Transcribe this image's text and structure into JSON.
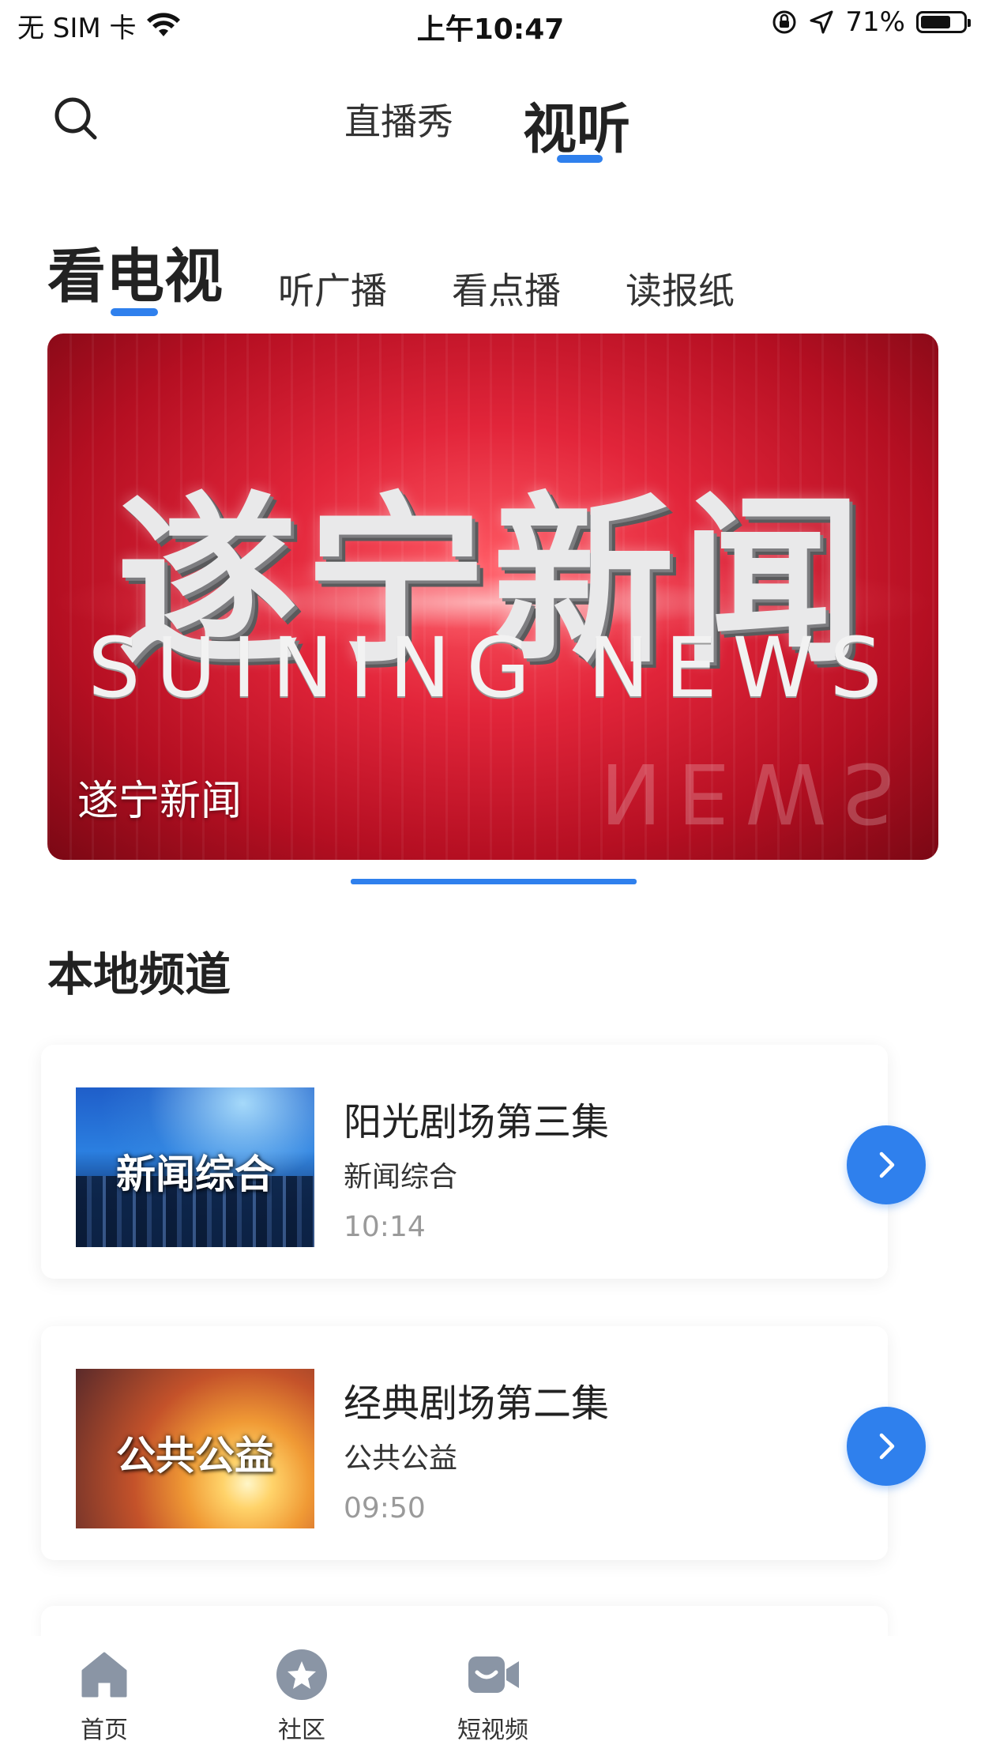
{
  "status_bar": {
    "carrier": "无 SIM 卡",
    "time": "上午10:47",
    "battery_percent": "71%",
    "battery_level": 0.71
  },
  "top_nav": {
    "tabs": [
      {
        "label": "直播秀",
        "active": false
      },
      {
        "label": "视听",
        "active": true
      }
    ]
  },
  "sub_tabs": [
    {
      "label": "看电视",
      "active": true
    },
    {
      "label": "听广播",
      "active": false
    },
    {
      "label": "看点播",
      "active": false
    },
    {
      "label": "读报纸",
      "active": false
    }
  ],
  "banner": {
    "title_cn": "遂宁新闻",
    "title_en": "SUINING NEWS",
    "reflection_text": "NEWS",
    "caption": "遂宁新闻"
  },
  "section": {
    "title": "本地频道"
  },
  "channels": [
    {
      "thumb_label": "新闻综合",
      "title": "阳光剧场第三集",
      "channel": "新闻综合",
      "time": "10:14"
    },
    {
      "thumb_label": "公共公益",
      "title": "经典剧场第二集",
      "channel": "公共公益",
      "time": "09:50"
    }
  ],
  "tab_bar": {
    "items": [
      {
        "label": "首页",
        "icon": "home-icon"
      },
      {
        "label": "社区",
        "icon": "star-circle-icon"
      },
      {
        "label": "短视频",
        "icon": "video-camera-icon"
      }
    ]
  },
  "colors": {
    "accent": "#2f80ed",
    "icon_gray": "#8a95a5"
  }
}
